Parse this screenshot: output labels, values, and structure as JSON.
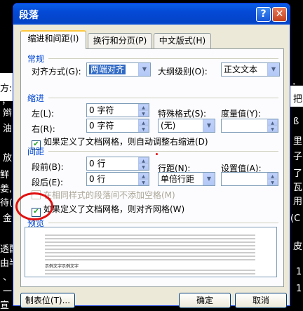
{
  "background_doc": {
    "chars_left": [
      "方:",
      "；",
      "辫",
      "油",
      "放",
      "鲜",
      "姜,",
      "待(",
      "金",
      "透配",
      "由半",
      "、",
      "一",
      "宣"
    ],
    "chars_right": [
      "：",
      "把",
      "ß",
      "里",
      "子",
      "了",
      "瓦",
      "用",
      "(C",
      "皮",
      "1",
      "1"
    ]
  },
  "dialog": {
    "title": "段落",
    "help_glyph": "?",
    "close_glyph": "✕"
  },
  "tabs": [
    {
      "label": "缩进和间距(I)",
      "active": true
    },
    {
      "label": "换行和分页(P)",
      "active": false
    },
    {
      "label": "中文版式(H)",
      "active": false
    }
  ],
  "general": {
    "section": "常规",
    "align_label": "对齐方式(G):",
    "align_value": "两端对齐",
    "outline_label": "大纲级别(O):",
    "outline_value": "正文文本"
  },
  "indent": {
    "section": "缩进",
    "left_label": "左(L):",
    "left_value": "0 字符",
    "right_label": "右(R):",
    "right_value": "0 字符",
    "special_label": "特殊格式(S):",
    "special_value": "(无)",
    "measure_label": "度量值(Y):",
    "measure_value": "",
    "auto_adjust_label": "如果定义了文档网格，则自动调整右缩进(D)",
    "auto_adjust_checked": true
  },
  "spacing": {
    "section": "间距",
    "before_label": "段前(B):",
    "before_value": "0 行",
    "after_label": "段后(E):",
    "after_value": "0 行",
    "line_label": "行距(N):",
    "line_value": "单倍行距",
    "setting_label": "设置值(A):",
    "setting_value": "",
    "no_space_label": "在相同样式的段落间不添加空格(M)",
    "no_space_checked": false,
    "snap_grid_label": "如果定义了文档网格，则对齐网格(W)",
    "snap_grid_checked": true
  },
  "preview": {
    "section": "预览",
    "sample_text": "示例文字示例文字"
  },
  "buttons": {
    "tabs": "制表位(T)...",
    "ok": "确定",
    "cancel": "取消"
  },
  "colors": {
    "title_blue": "#0449d6",
    "section_blue": "#0046d5",
    "annotation_red": "#e01010"
  }
}
